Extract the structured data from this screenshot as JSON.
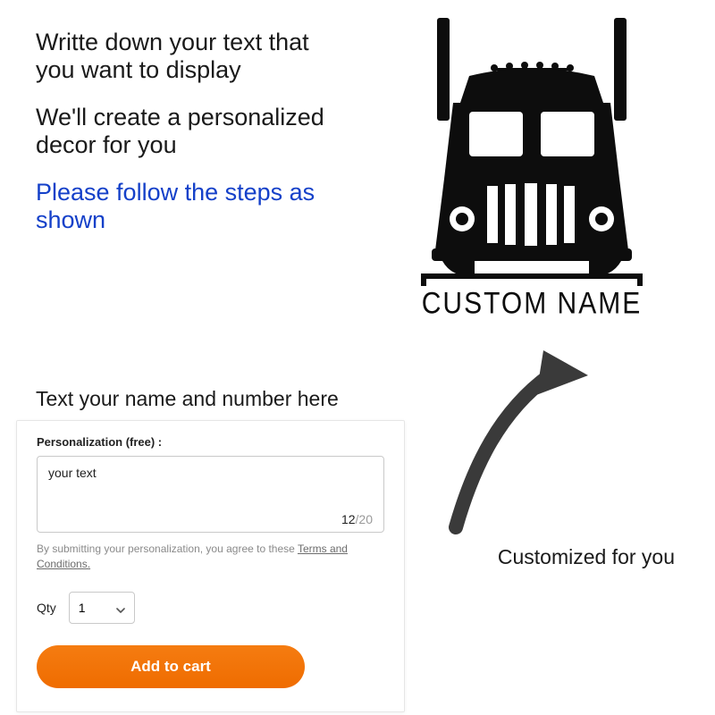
{
  "instructions": {
    "line1": "Writte down your text that you want to display",
    "line2": "We'll create a per­sonalized decor for you",
    "highlight": "Please follow the steps as shown"
  },
  "product": {
    "name_text": "CUSTOM NAME",
    "caption": "Customized for you"
  },
  "form": {
    "heading": "Text your name and number here",
    "personalization_label": "Personalization (free) :",
    "entered_text": "your text",
    "count_current": "12",
    "count_limit": "/20",
    "disclaimer_prefix": "By submitting your personalization, you agree to these ",
    "terms_label": "Terms and Conditions.",
    "qty_label": "Qty",
    "qty_value": "1",
    "add_button": "Add to cart"
  }
}
